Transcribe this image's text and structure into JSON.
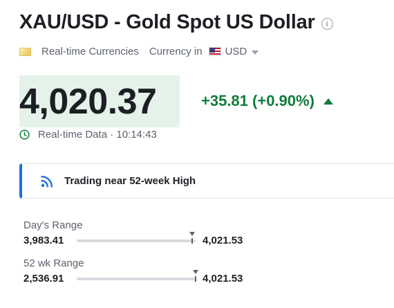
{
  "header": {
    "title": "XAU/USD - Gold Spot US Dollar",
    "info_icon": "info-icon"
  },
  "meta": {
    "category": "Real-time Currencies",
    "currency_label": "Currency in",
    "currency": "USD"
  },
  "quote": {
    "price": "4,020.37",
    "change": "+35.81 (+0.90%)",
    "direction": "up",
    "price_bg_color": "#e5f2e9",
    "change_color": "#0e7c3a"
  },
  "realtime": {
    "text": "Real-time Data · 10:14:43"
  },
  "alert": {
    "text": "Trading near 52-week High",
    "accent_color": "#1d6fdc"
  },
  "ranges": {
    "day": {
      "label": "Day's Range",
      "low": "3,983.41",
      "high": "4,021.53",
      "current_fraction": 0.97
    },
    "week52": {
      "label": "52 wk Range",
      "low": "2,536.91",
      "high": "4,021.53",
      "current_fraction": 0.999
    }
  }
}
